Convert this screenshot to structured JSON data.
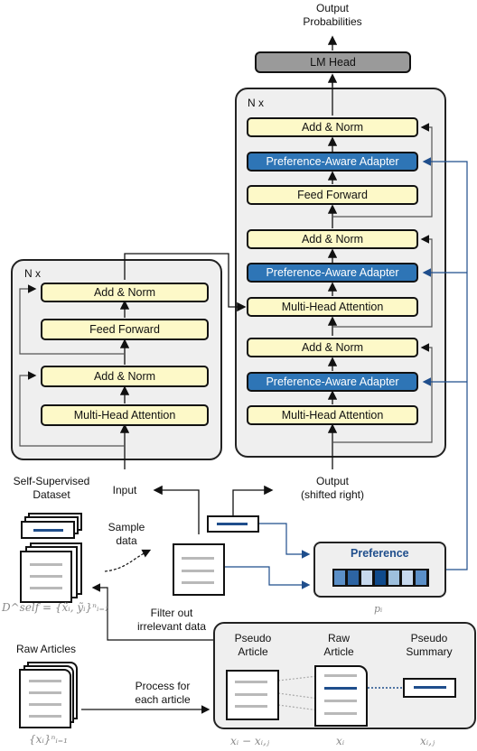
{
  "output": {
    "title_line1": "Output",
    "title_line2": "Probabilities"
  },
  "decoder": {
    "repeat_label": "N x",
    "lm_head": "LM Head",
    "blocks": [
      {
        "label": "Add & Norm",
        "kind": "add-norm"
      },
      {
        "label": "Preference-Aware Adapter",
        "kind": "adapter"
      },
      {
        "label": "Feed Forward",
        "kind": "feed-forward"
      },
      {
        "label": "Add & Norm",
        "kind": "add-norm"
      },
      {
        "label": "Preference-Aware Adapter",
        "kind": "adapter"
      },
      {
        "label": "Multi-Head Attention",
        "kind": "attention"
      },
      {
        "label": "Add & Norm",
        "kind": "add-norm"
      },
      {
        "label": "Preference-Aware Adapter",
        "kind": "adapter"
      },
      {
        "label": "Multi-Head Attention",
        "kind": "attention"
      }
    ],
    "input_line1": "Output",
    "input_line2": "(shifted right)"
  },
  "encoder": {
    "repeat_label": "N x",
    "blocks": [
      {
        "label": "Add & Norm",
        "kind": "add-norm"
      },
      {
        "label": "Feed Forward",
        "kind": "feed-forward"
      },
      {
        "label": "Add & Norm",
        "kind": "add-norm"
      },
      {
        "label": "Multi-Head Attention",
        "kind": "attention"
      }
    ],
    "input_label": "Input"
  },
  "dataset": {
    "title_line1": "Self-Supervised",
    "title_line2": "Dataset",
    "formula": "D^self = {x̃ᵢ, ỹᵢ}ⁿᵢ₌₁",
    "sample_line1": "Sample",
    "sample_line2": "data"
  },
  "preference": {
    "title": "Preference",
    "symbol": "pᵢ",
    "cells": [
      "#5b8fc7",
      "#2d64a3",
      "#c7d9ee",
      "#0f4a8c",
      "#9dbfdd",
      "#c7d9ee",
      "#5b8fc7"
    ]
  },
  "filter": {
    "line1": "Filter out",
    "line2": "irrelevant data"
  },
  "raw_articles": {
    "title": "Raw Articles",
    "formula": "{xᵢ}ⁿᵢ₌₁"
  },
  "process": {
    "line1": "Process for",
    "line2": "each article"
  },
  "pseudo": {
    "pseudo_article_line1": "Pseudo",
    "pseudo_article_line2": "Article",
    "raw_article_line1": "Raw",
    "raw_article_line2": "Article",
    "pseudo_summary_line1": "Pseudo",
    "pseudo_summary_line2": "Summary",
    "formula_article": "xᵢ − xᵢ,ⱼ",
    "formula_raw": "xᵢ",
    "formula_summary": "xᵢ,ⱼ"
  },
  "colors": {
    "adapter": "#2e75b6",
    "sublayer": "#fdf9c8",
    "lm_head": "#9a9a9a",
    "pref_accent": "#1f4e8c"
  }
}
